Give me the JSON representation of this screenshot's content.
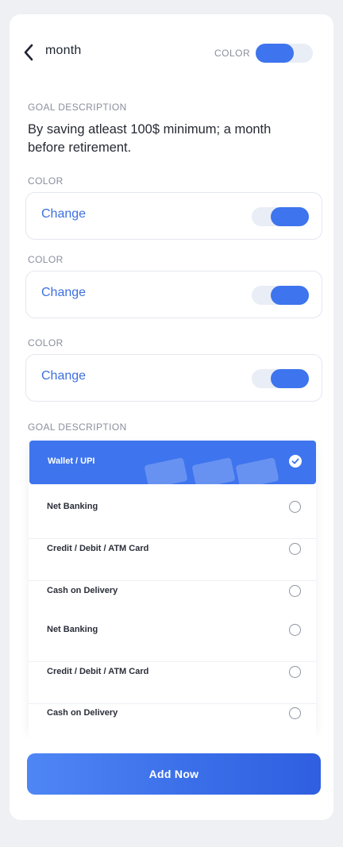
{
  "header": {
    "title": "month",
    "color_label": "COLOR",
    "toggle_on": true
  },
  "goal": {
    "section_label": "GOAL DESCRIPTION",
    "text": "By saving atleast 100$ minimum; a month before retirement."
  },
  "color_options": [
    {
      "section_label": "COLOR",
      "action_label": "Change",
      "toggle_on": true
    },
    {
      "section_label": "COLOR",
      "action_label": "Change",
      "toggle_on": true
    },
    {
      "section_label": "COLOR",
      "action_label": "Change",
      "toggle_on": true
    }
  ],
  "payment": {
    "section_label": "GOAL DESCRIPTION",
    "selected_index": 0,
    "items": [
      {
        "label": "Wallet / UPI",
        "icon": "wallet-icon"
      },
      {
        "label": "Net Banking"
      },
      {
        "label": "Credit / Debit / ATM Card"
      },
      {
        "label": "Cash on Delivery"
      },
      {
        "label": "Net Banking"
      },
      {
        "label": "Credit / Debit / ATM Card"
      },
      {
        "label": "Cash on Delivery"
      }
    ]
  },
  "add_button": {
    "label": "Add Now"
  },
  "colors": {
    "accent": "#3e74ee",
    "background": "#eef0f4",
    "card": "#ffffff",
    "muted_text": "#8a8f9c"
  }
}
